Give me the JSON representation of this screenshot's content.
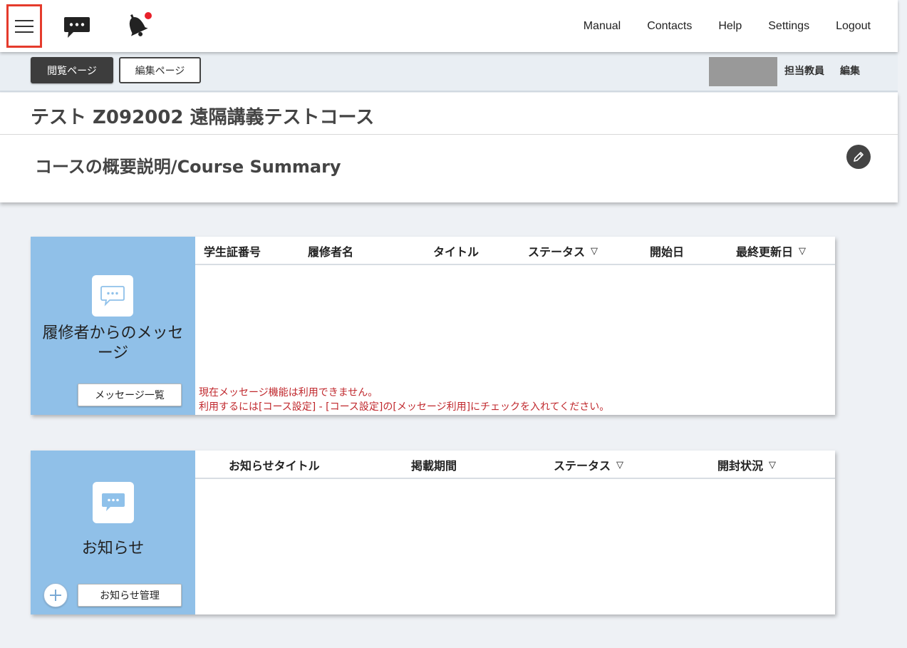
{
  "topbar": {
    "nav": [
      "Manual",
      "Contacts",
      "Help",
      "Settings",
      "Logout"
    ]
  },
  "subbar": {
    "view_label": "閲覧ページ",
    "edit_label": "編集ページ",
    "teacher_label": "担当教員",
    "teacher_edit_label": "編集"
  },
  "course": {
    "title": "テスト Z092002 遠隔講義テストコース",
    "summary_title": "コースの概要説明/Course Summary"
  },
  "messages_panel": {
    "label": "履修者からのメッセージ",
    "button_label": "メッセージ一覧",
    "columns": [
      "学生証番号",
      "履修者名",
      "タイトル",
      "ステータス",
      "開始日",
      "最終更新日"
    ],
    "sort_mark": "▽",
    "notice_line1": "現在メッセージ機能は利用できません。",
    "notice_line2": "利用するには[コース設定] - [コース設定]の[メッセージ利用]にチェックを入れてください。"
  },
  "news_panel": {
    "label": "お知らせ",
    "button_label": "お知らせ管理",
    "columns": [
      "お知らせタイトル",
      "掲載期間",
      "ステータス",
      "開封状況"
    ],
    "sort_mark": "▽"
  },
  "colors": {
    "accent_red": "#e53b2c",
    "side_blue": "#90c0e8",
    "notice_red": "#c0282d",
    "dark_button": "#3d3d3d"
  }
}
